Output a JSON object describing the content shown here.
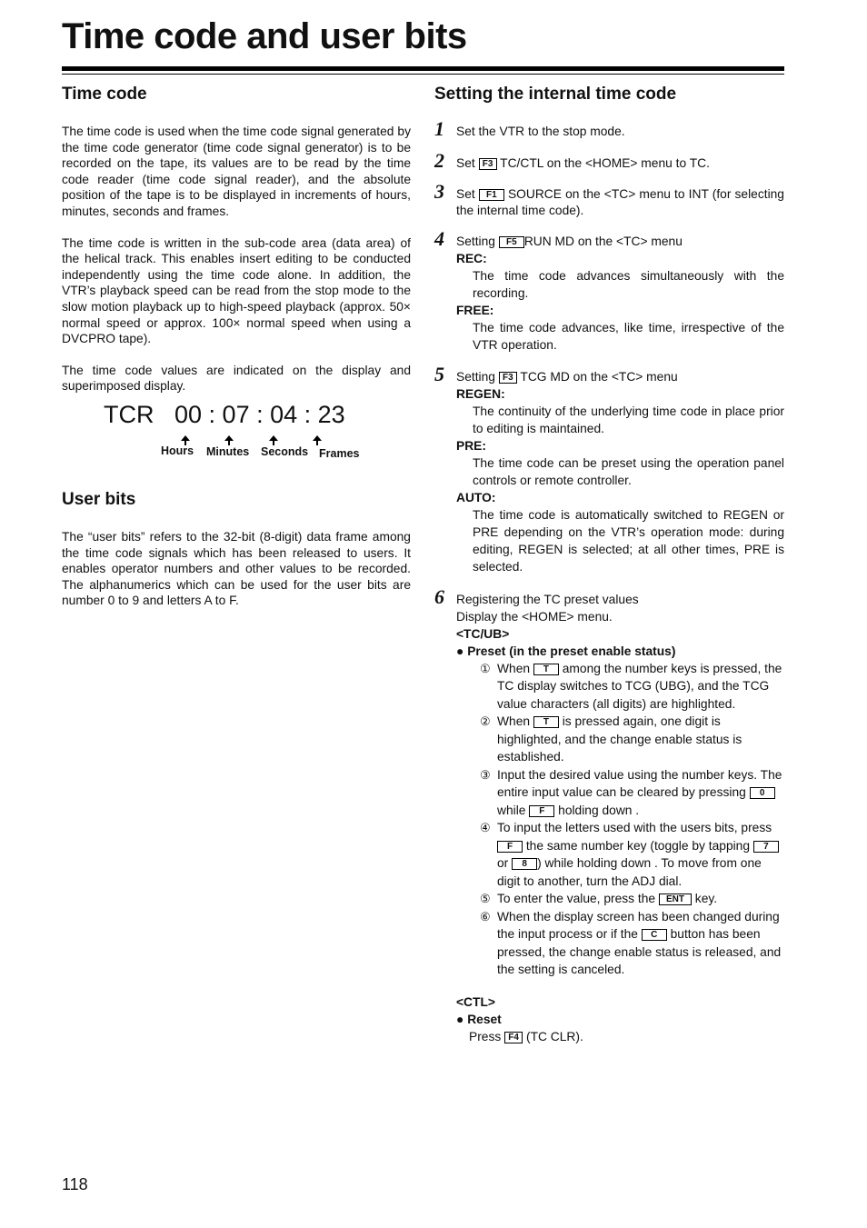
{
  "page": {
    "title": "Time code and user bits",
    "page_number": "118"
  },
  "left": {
    "time_code": {
      "heading": "Time code",
      "paragraphs": [
        "The time code is used when the time code signal generated by the time code generator (time code signal generator) is to be recorded on the tape, its values are to be read by the time code reader (time code signal reader), and the absolute position of the tape is to be displayed in increments of hours, minutes, seconds and frames.",
        "The time code is written in the sub-code area (data area) of the helical track.  This enables insert editing to be conducted independently using the time code alone.  In addition, the VTR’s playback speed can be read from the stop mode to the slow motion playback up to high-speed playback (approx. 50× normal speed or approx. 100× normal speed when using a DVCPRO tape).",
        "The time code values are indicated on the display and superimposed display."
      ],
      "display": {
        "prefix": "TCR",
        "value": "00 : 07 : 04 : 23",
        "labels": [
          "Hours",
          "Minutes",
          "Seconds",
          "Frames"
        ]
      }
    },
    "user_bits": {
      "heading": "User bits",
      "paragraph": "The “user bits” refers to the 32-bit (8-digit) data frame among the time code signals which has been released to users.  It enables operator numbers and other values to be recorded. The alphanumerics which can be used for the user bits are number 0 to 9 and letters A to F."
    }
  },
  "right": {
    "heading": "Setting the internal time code",
    "steps": [
      {
        "num": "1",
        "text": "Set the VTR to the stop mode."
      },
      {
        "num": "2",
        "pre": "Set",
        "key": "F3",
        "post": "TC/CTL on the <HOME> menu to TC."
      },
      {
        "num": "3",
        "pre": "Set",
        "key": "F1",
        "post": "SOURCE on the <TC> menu to INT (for selecting the internal time code)."
      },
      {
        "num": "4",
        "pre": "Setting",
        "key": "F5",
        "post": "RUN MD on the <TC> menu",
        "options": [
          {
            "term": "REC:",
            "desc": "The time code advances simultaneously with the recording."
          },
          {
            "term": "FREE:",
            "desc": "The time code advances, like time, irrespective of the VTR operation."
          }
        ]
      },
      {
        "num": "5",
        "pre": "Setting",
        "key": "F3",
        "post": "TCG MD on the <TC> menu",
        "options": [
          {
            "term": "REGEN:",
            "desc": "The continuity of the underlying time code in place prior to editing is maintained."
          },
          {
            "term": "PRE:",
            "desc": "The time code can be preset using the operation panel controls or remote controller."
          },
          {
            "term": "AUTO:",
            "desc": "The time code is automatically switched to REGEN or PRE depending on the VTR’s operation mode: during editing, REGEN is selected; at all other times, PRE is selected."
          }
        ]
      },
      {
        "num": "6",
        "line1": "Registering the TC preset values",
        "line2": "Display the <HOME> menu.",
        "tcub_label": "<TC/UB>",
        "preset_bullet": "Preset (in the preset enable status)",
        "sub": [
          {
            "mark": "①",
            "a": "When",
            "k1": "T",
            "b": "among the number keys is pressed, the TC display switches to TCG (UBG), and the TCG value characters (all digits) are highlighted."
          },
          {
            "mark": "②",
            "a": "When",
            "k1": "T",
            "b": "is pressed again, one digit is highlighted, and the change enable status is established."
          },
          {
            "mark": "③",
            "a": "Input the desired value using the number keys. The entire input value can be cleared by pressing",
            "k1": "0",
            "b": "while",
            "k2": "F",
            "c": "holding down ."
          },
          {
            "mark": "④",
            "a": "To input the letters used with the users bits, press",
            "k1": "F",
            "b": "the same number key (toggle by tapping",
            "k2": "7",
            "c": "or",
            "k3": "8",
            "d": ") while holding down . To move from one digit to another, turn the ADJ dial."
          },
          {
            "mark": "⑤",
            "a": "To enter the value, press the",
            "k1": "ENT",
            "b": "key."
          },
          {
            "mark": "⑥",
            "a": "When the display screen has been changed during the input process or if the",
            "k1": "C",
            "b": "button has been pressed, the change enable status is released, and the setting is canceled."
          }
        ],
        "ctl_label": "<CTL>",
        "reset_bullet": "Reset",
        "reset_pre": "Press",
        "reset_key": "F4",
        "reset_post": "(TC CLR)."
      }
    ]
  }
}
